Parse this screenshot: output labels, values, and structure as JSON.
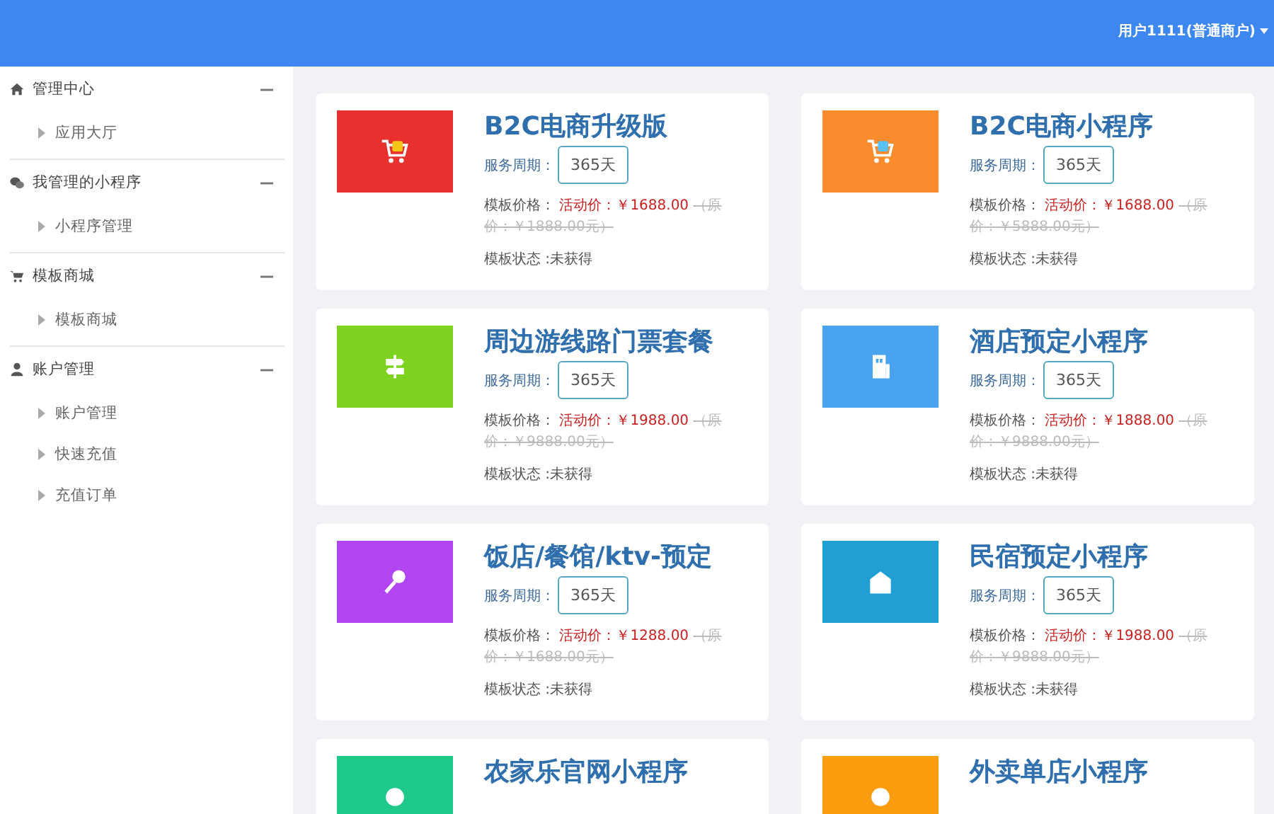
{
  "header": {
    "user": "用户1111(普通商户)"
  },
  "sidebar": {
    "groups": [
      {
        "title": "管理中心",
        "expanded": true,
        "children": [
          {
            "label": "应用大厅"
          }
        ]
      },
      {
        "title": "我管理的小程序",
        "expanded": true,
        "children": [
          {
            "label": "小程序管理"
          }
        ]
      },
      {
        "title": "模板商城",
        "expanded": true,
        "children": [
          {
            "label": "模板商城"
          }
        ]
      },
      {
        "title": "账户管理",
        "expanded": true,
        "children": [
          {
            "label": "账户管理"
          },
          {
            "label": "快速充值"
          },
          {
            "label": "充值订单"
          }
        ]
      }
    ]
  },
  "cards": [
    {
      "title": "B2C电商升级版",
      "color": "#e8312f",
      "period_label": "服务周期：",
      "period": "365天",
      "price_label": "模板价格：",
      "promo": "活动价：￥1688.00",
      "original": "（原价：￥1888.00元）",
      "status": "模板状态 :未获得"
    },
    {
      "title": "B2C电商小程序",
      "color": "#fb8c2d",
      "period_label": "服务周期：",
      "period": "365天",
      "price_label": "模板价格：",
      "promo": "活动价：￥1688.00",
      "original": "（原价：￥5888.00元）",
      "status": "模板状态 :未获得"
    },
    {
      "title": "周边游线路门票套餐",
      "color": "#7ed321",
      "period_label": "服务周期：",
      "period": "365天",
      "price_label": "模板价格：",
      "promo": "活动价：￥1988.00",
      "original": "（原价：￥9888.00元）",
      "status": "模板状态 :未获得"
    },
    {
      "title": "酒店预定小程序",
      "color": "#4aa3ef",
      "period_label": "服务周期：",
      "period": "365天",
      "price_label": "模板价格：",
      "promo": "活动价：￥1888.00",
      "original": "（原价：￥9888.00元）",
      "status": "模板状态 :未获得"
    },
    {
      "title": "饭店/餐馆/ktv-预定",
      "color": "#b146f0",
      "period_label": "服务周期：",
      "period": "365天",
      "price_label": "模板价格：",
      "promo": "活动价：￥1288.00",
      "original": "（原价：￥1688.00元）",
      "status": "模板状态 :未获得"
    },
    {
      "title": "民宿预定小程序",
      "color": "#1f9fd3",
      "period_label": "服务周期：",
      "period": "365天",
      "price_label": "模板价格：",
      "promo": "活动价：￥1988.00",
      "original": "（原价：￥9888.00元）",
      "status": "模板状态 :未获得"
    },
    {
      "title": "农家乐官网小程序",
      "color": "#1ec98a"
    },
    {
      "title": "外卖单店小程序",
      "color": "#fb9d0e"
    }
  ]
}
